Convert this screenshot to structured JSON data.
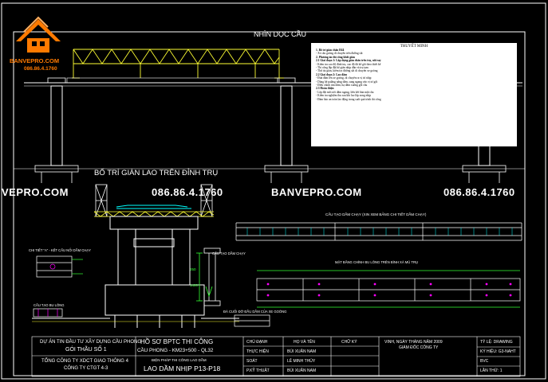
{
  "logo": {
    "name": "BANVEPRO.COM",
    "phone": "086.86.4.1760"
  },
  "elevation": {
    "title": "NHÌN DỌC CẦU",
    "subtitle": "BỐ TRÍ GIÀN LAO TRÊN ĐỈNH TRỤ"
  },
  "watermarks": {
    "left": "VEPRO.COM",
    "phone_center": "086.86.4.1760",
    "center": "BANVEPRO.COM",
    "phone_right": "086.86.4.1760"
  },
  "notes": {
    "title": "THUYẾT MINH",
    "lines": [
      "1. Bố trí giàn chân Đ24",
      "- Xe cẩu goòng di chuyển trên đường sắt",
      "2. Phương án thi công khối giàn",
      "2.1 Giai đoạn 1: Lắp dựng giàn chân trên trụ, nối ray",
      "- Kiểm tra cao độ đỉnh trụ, cao độ đá kê gối theo thiết kế",
      "- Thi công lắp đặt hệ giàn nhịp dẫn và trụ tạm",
      "- Thử tải giàn, kiểm tra đường sắt di chuyển xe goòng",
      "2.2 Giai đoạn 2: Lao dầm",
      "- Đưa dầm lên xe goòng, di chuyển ra vị trí nhịp",
      "- Dùng hệ palăng nâng dầm, sang ngang vào vị trí gối",
      "- Điều chỉnh tim dầm, hạ dầm xuống gối cầu",
      "2.3 Hoàn thiện",
      "- Lắp đặt mối nối dầm ngang, liên kết bản mặt cầu",
      "- Kiểm tra nghiệm thu sau khi lao lắp xong nhịp",
      "- Đảm bảo an toàn lao động trong suốt quá trình thi công"
    ]
  },
  "labels": {
    "girder_detail": "CẤU TẠO DẦM CHẠY (XIN XEM BẢNG CHI TIẾT DẦM CHẠY)",
    "detail_a": "CHI TIẾT \"A\" - KẾT CẤU NỐI DẦM CHẠY",
    "runway_beam": "CẤU TẠO DẦM CHẠY",
    "girder_bottom": "CẤU TẠO BU LÔNG",
    "plan_view": "MẶT BẰNG CHÍNH BU LÔNG TRÊN BÌNH XÀ MŨ TRỤ",
    "end_support": "ĐÀ CUỐI ĐỠ ĐẦU DẦM CỦA XE GOÒNG",
    "dim_250": "250",
    "dim_1400": "1400"
  },
  "title_block": {
    "project": "DỰ ÁN TIN ĐẦU TƯ XÂY DỰNG CẦU PHONG",
    "package": "GÓI THẦU SỐ 1",
    "company": "TỔNG CÔNG TY XDCT GIAO THÔNG 4",
    "company2": "CÔNG TY CTGT 4-3",
    "doc_title": "HỒ SƠ BPTC THI CÔNG",
    "bridge": "CẦU PHONG - KM23+500 - QL32",
    "method": "BIỆN PHÁP THI CÔNG LAO DẦM",
    "drawing": "LAO DẦM NHỊP P13-P18",
    "roles": [
      "CHỦ ĐẠNH",
      "THỰC HIỆN",
      "SOÁT",
      "P.KỸ THUẬT"
    ],
    "names_header": "HỌ VÀ TÊN",
    "names": [
      "BÙI XUÂN NAM",
      "LÊ MINH THỦY",
      "BÙI XUÂN NAM"
    ],
    "sign_header": "CHỮ KÝ",
    "date_line": "VINH, NGÀY THÁNG NĂM 2009",
    "director": "GIÁM ĐỐC CÔNG TY",
    "scale": "TỶ LỆ: DRAWING",
    "symbol": "KÝ HIỆU: G3-NAHT",
    "ver": "BVC",
    "sheet": "LẦN THỨ: 1"
  },
  "colors": {
    "background": "#000000",
    "drawing_white": "#ffffff",
    "truss_yellow": "#ffff33",
    "dim_green": "#33ff33",
    "cyan": "#00ffff",
    "magenta": "#ff00ff",
    "logo_orange": "#ff7a00"
  }
}
